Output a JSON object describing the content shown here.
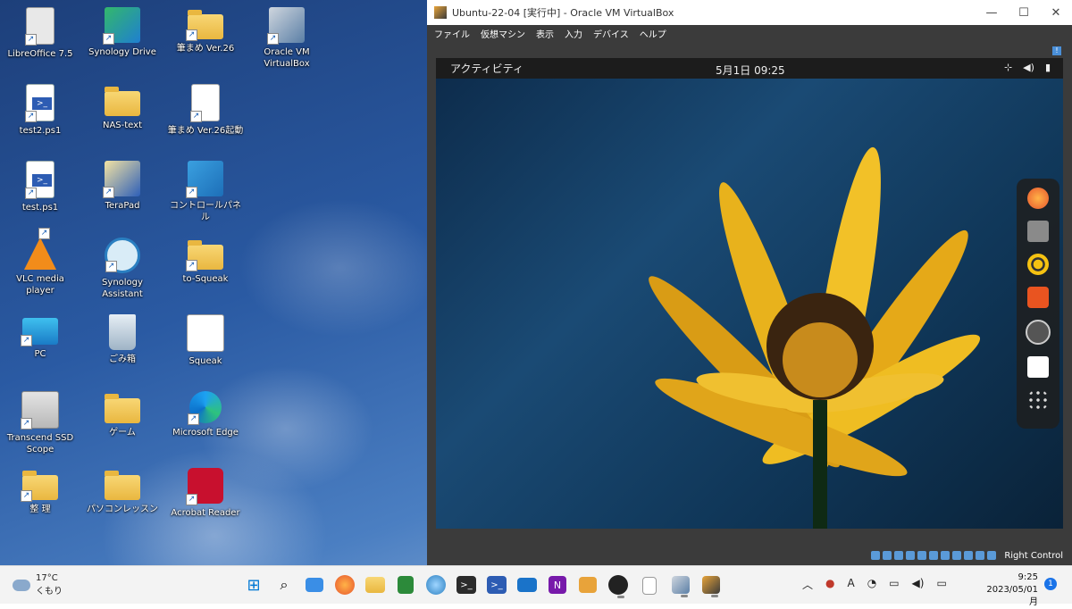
{
  "desktop": {
    "icons": [
      {
        "label": "LibreOffice 7.5"
      },
      {
        "label": "Synology Drive"
      },
      {
        "label": "筆まめ Ver.26"
      },
      {
        "label": "Oracle VM\nVirtualBox"
      },
      {
        "label": "test2.ps1"
      },
      {
        "label": "NAS-text"
      },
      {
        "label": "筆まめ Ver.26起動"
      },
      {
        "label": "test.ps1"
      },
      {
        "label": "TeraPad"
      },
      {
        "label": "コントロールパネル"
      },
      {
        "label": "VLC media player"
      },
      {
        "label": "Synology Assistant"
      },
      {
        "label": "to-Squeak"
      },
      {
        "label": "PC"
      },
      {
        "label": "ごみ箱"
      },
      {
        "label": "Squeak"
      },
      {
        "label": "Transcend SSD\nScope"
      },
      {
        "label": "ゲーム"
      },
      {
        "label": "Microsoft Edge"
      },
      {
        "label": "整 理"
      },
      {
        "label": "パソコンレッスン"
      },
      {
        "label": "Acrobat Reader"
      }
    ]
  },
  "vbox": {
    "title": "Ubuntu-22-04 [実行中] - Oracle VM VirtualBox",
    "menu": [
      "ファイル",
      "仮想マシン",
      "表示",
      "入力",
      "デバイス",
      "ヘルプ"
    ],
    "guest": {
      "activities": "アクティビティ",
      "clock": "5月1日  09:25"
    },
    "status_host_key": "Right Control"
  },
  "taskbar": {
    "weather_temp": "17°C",
    "weather_desc": "くもり",
    "time": "9:25",
    "date": "2023/05/01 月",
    "ime": "A",
    "notification_count": "1"
  }
}
